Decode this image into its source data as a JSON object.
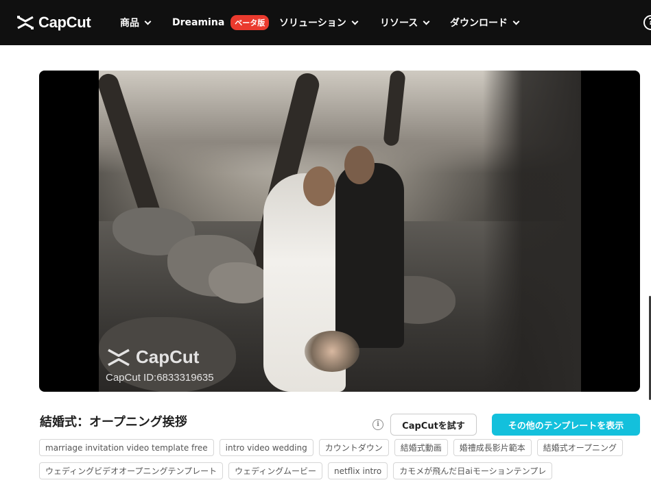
{
  "nav": {
    "brand": "CapCut",
    "items": [
      {
        "label": "商品"
      },
      {
        "label": "Dreamina",
        "badge": "ベータ版"
      },
      {
        "label": "ソリューション"
      },
      {
        "label": "リソース"
      },
      {
        "label": "ダウンロード"
      }
    ],
    "help_label": "?"
  },
  "video": {
    "watermark_brand": "CapCut",
    "watermark_id": "CapCut ID:6833319635"
  },
  "template": {
    "title": "結婚式：オープニング挨拶",
    "info_icon": "i",
    "try_button": "CapCutを試す",
    "more_button": "その他のテンプレートを表示"
  },
  "tags": [
    [
      "marriage invitation video template free",
      "intro video wedding",
      "カウントダウン",
      "結婚式動画",
      "婚禮成長影片範本",
      "結婚式オープニング"
    ],
    [
      "ウェディングビデオオープニングテンプレート",
      "ウェディングムービー",
      "netflix intro",
      "カモメが飛んだ日aiモーションテンプレ"
    ]
  ],
  "colors": {
    "nav_bg": "#101010",
    "beta_badge": "#ea3a2e",
    "primary_button": "#13c0dc"
  }
}
